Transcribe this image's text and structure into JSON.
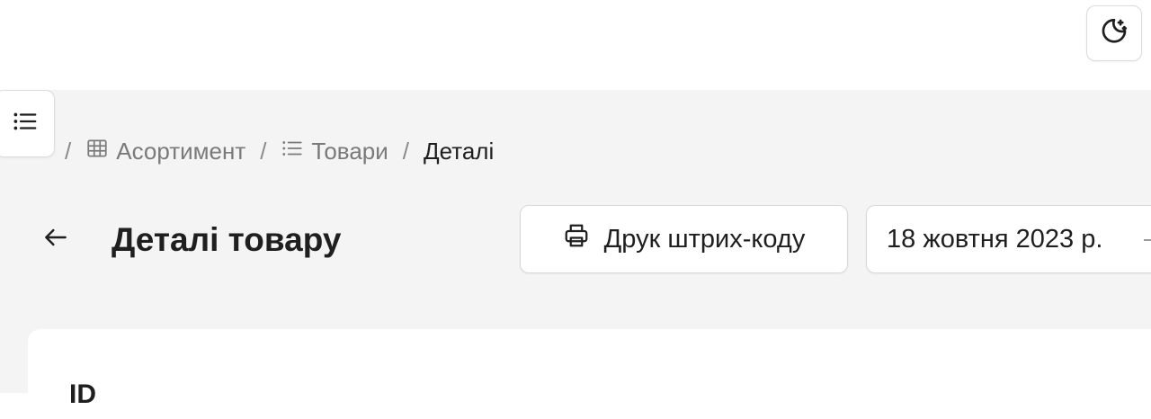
{
  "theme_toggle": {
    "icon": "moon-stars-icon"
  },
  "sidebar_toggle": {
    "icon": "list-icon"
  },
  "breadcrumb": {
    "items": [
      {
        "label": "",
        "icon": "home-icon"
      },
      {
        "label": "Асортимент",
        "icon": "table-icon"
      },
      {
        "label": "Товари",
        "icon": "list-icon"
      },
      {
        "label": "Деталі",
        "icon": ""
      }
    ],
    "separator": "/"
  },
  "header": {
    "title": "Деталі товару",
    "back_icon": "arrow-left-icon",
    "print_button_label": "Друк штрих-коду",
    "print_icon": "printer-icon",
    "date_value": "18 жовтня 2023 р."
  },
  "card": {
    "first_label": "ID"
  }
}
